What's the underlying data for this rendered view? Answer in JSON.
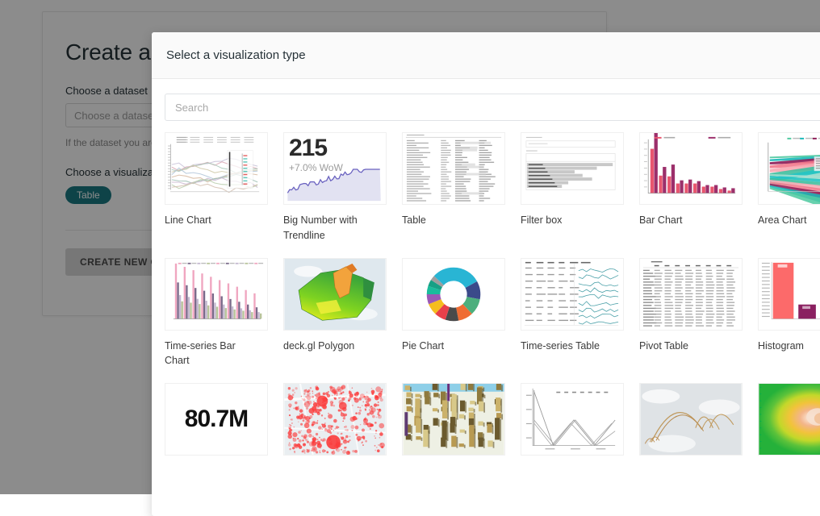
{
  "background_page": {
    "title": "Create a new chart",
    "dataset_label": "Choose a dataset",
    "dataset_select_value": "Choose a dataset",
    "help_text": "If the dataset you are looking for is not available",
    "visualization_label": "Choose a visualization type",
    "selected_viz_pill": "Table",
    "create_button": "CREATE NEW CHART"
  },
  "modal": {
    "title": "Select a visualization type",
    "search": {
      "placeholder": "Search",
      "value": ""
    },
    "viz_types": [
      {
        "label": "Line Chart",
        "thumb": "line-chart"
      },
      {
        "label": "Big Number with Trendline",
        "thumb": "big-number-trendline",
        "big_value": "215",
        "sub_value": "+7.0% WoW"
      },
      {
        "label": "Table",
        "thumb": "table"
      },
      {
        "label": "Filter box",
        "thumb": "filter-box"
      },
      {
        "label": "Bar Chart",
        "thumb": "bar-chart"
      },
      {
        "label": "Area Chart",
        "thumb": "area-chart"
      },
      {
        "label": "Time-series Bar Chart",
        "thumb": "timeseries-bar-chart"
      },
      {
        "label": "deck.gl Polygon",
        "thumb": "deckgl-polygon"
      },
      {
        "label": "Pie Chart",
        "thumb": "pie-chart"
      },
      {
        "label": "Time-series Table",
        "thumb": "timeseries-table"
      },
      {
        "label": "Pivot Table",
        "thumb": "pivot-table"
      },
      {
        "label": "Histogram",
        "thumb": "histogram"
      },
      {
        "label": "",
        "thumb": "big-number",
        "big_value": "80.7M"
      },
      {
        "label": "",
        "thumb": "deckgl-scatter"
      },
      {
        "label": "",
        "thumb": "deckgl-grid"
      },
      {
        "label": "",
        "thumb": "parallel-coordinates"
      },
      {
        "label": "",
        "thumb": "deckgl-arc"
      },
      {
        "label": "",
        "thumb": "heatmap"
      }
    ]
  },
  "colors": {
    "accent_teal": "#1a7b84",
    "bar_pink": "#e04c77",
    "bar_magenta": "#9c2f6b",
    "histogram_red": "#fc6a6a",
    "overlay": "rgba(0,0,0,.45)",
    "pie_palette": [
      "#29b5d4",
      "#3b4a8a",
      "#4caf7d",
      "#ef6c33",
      "#4a4a4a",
      "#e8404a",
      "#f5bd1f",
      "#9b59b6",
      "#1abc9c",
      "#16a085",
      "#9e9e9e",
      "#29b5d4"
    ]
  }
}
